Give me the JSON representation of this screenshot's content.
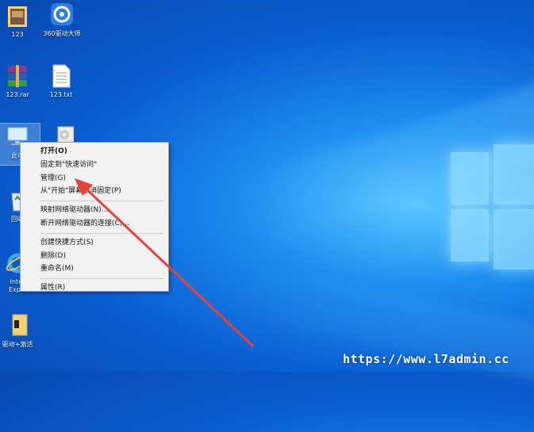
{
  "desktop": {
    "icons": [
      {
        "label": "123",
        "type": "folder-photo"
      },
      {
        "label": "360驱动大师",
        "type": "gear-app"
      },
      {
        "label": "123.rar",
        "type": "winrar"
      },
      {
        "label": "123.txt",
        "type": "text-file"
      },
      {
        "label": "此电",
        "type": "computer"
      },
      {
        "label": "",
        "type": "disc"
      },
      {
        "label": "回收",
        "type": "recycle-bin"
      },
      {
        "label": "Inter\nExplo",
        "type": "ie"
      },
      {
        "label": "驱动+激活",
        "type": "folder"
      }
    ]
  },
  "context_menu": {
    "items": [
      {
        "label": "打开(O)",
        "bold": true
      },
      {
        "label": "固定到\"快速访问\""
      },
      {
        "label": "管理(G)"
      },
      {
        "label": "从\"开始\"屏幕取消固定(P)"
      },
      {
        "label": "映射网络驱动器(N)..."
      },
      {
        "label": "断开网络驱动器的连接(C)..."
      },
      {
        "label": "创建快捷方式(S)"
      },
      {
        "label": "删除(D)"
      },
      {
        "label": "重命名(M)"
      },
      {
        "label": "属性(R)"
      }
    ]
  },
  "watermark": "https://www.l7admin.cc",
  "colors": {
    "arrow": "#e8403a",
    "menu_bg": "#f2f2f2"
  }
}
